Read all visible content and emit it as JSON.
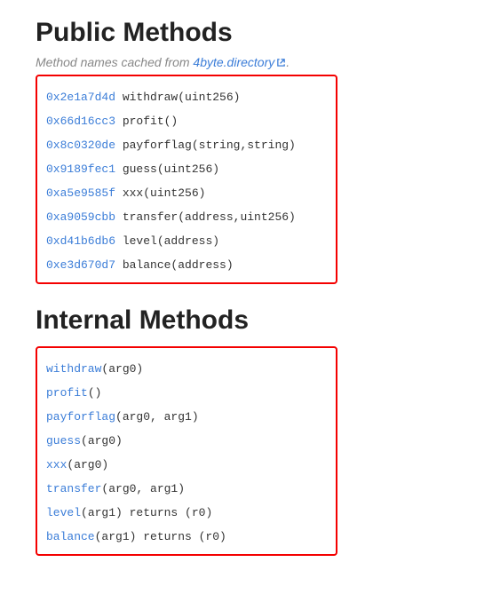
{
  "sections": {
    "public": {
      "heading": "Public Methods",
      "subtitle_prefix": "Method names cached from ",
      "subtitle_link_text": "4byte.directory",
      "subtitle_suffix": ".",
      "methods": [
        {
          "hash": "0x2e1a7d4d",
          "sig": "withdraw(uint256)"
        },
        {
          "hash": "0x66d16cc3",
          "sig": "profit()"
        },
        {
          "hash": "0x8c0320de",
          "sig": "payforflag(string,string)"
        },
        {
          "hash": "0x9189fec1",
          "sig": "guess(uint256)"
        },
        {
          "hash": "0xa5e9585f",
          "sig": "xxx(uint256)"
        },
        {
          "hash": "0xa9059cbb",
          "sig": "transfer(address,uint256)"
        },
        {
          "hash": "0xd41b6db6",
          "sig": "level(address)"
        },
        {
          "hash": "0xe3d670d7",
          "sig": "balance(address)"
        }
      ]
    },
    "internal": {
      "heading": "Internal Methods",
      "methods": [
        {
          "name": "withdraw",
          "args": "(arg0)",
          "ret": ""
        },
        {
          "name": "profit",
          "args": "()",
          "ret": ""
        },
        {
          "name": "payforflag",
          "args": "(arg0, arg1)",
          "ret": ""
        },
        {
          "name": "guess",
          "args": "(arg0)",
          "ret": ""
        },
        {
          "name": "xxx",
          "args": "(arg0)",
          "ret": ""
        },
        {
          "name": "transfer",
          "args": "(arg0, arg1)",
          "ret": ""
        },
        {
          "name": "level",
          "args": "(arg1)",
          "ret": " returns (r0)"
        },
        {
          "name": "balance",
          "args": "(arg1)",
          "ret": " returns (r0)"
        }
      ]
    }
  }
}
